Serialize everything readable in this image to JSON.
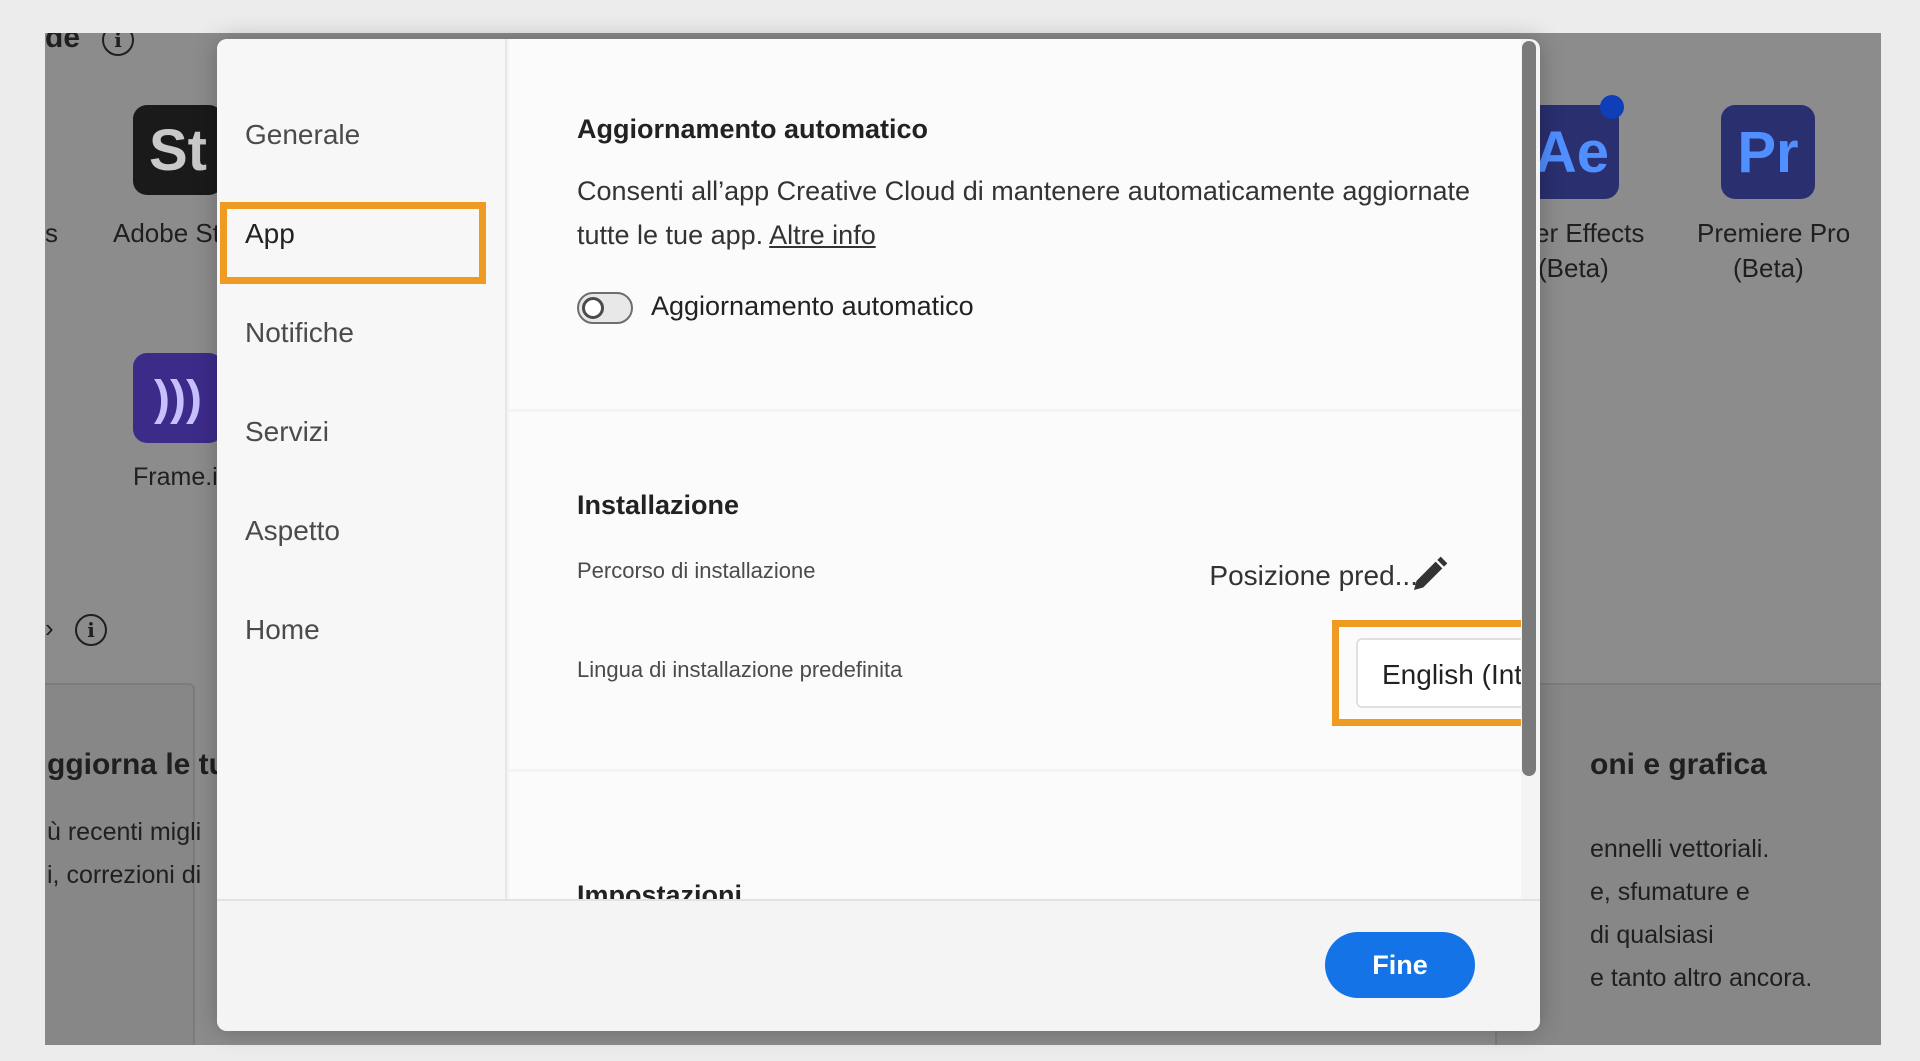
{
  "background": {
    "top_left_text": "de",
    "apps": [
      {
        "icon_text": "St",
        "label": "Adobe St",
        "icon_color": "#1a1a1a",
        "text_color": "#c9c9c9"
      },
      {
        "icon_text": "Ae",
        "label": "er Effects",
        "sublabel": "(Beta)",
        "icon_color": "#2a2f6f",
        "text_color": "#4f8fff"
      },
      {
        "icon_text": "Pr",
        "label": "Premiere Pro",
        "sublabel": "(Beta)",
        "icon_color": "#2a2f6f",
        "text_color": "#4f8fff"
      }
    ],
    "frame_label": "Frame.i",
    "left_partial_label": "s",
    "section_marker": "›",
    "left_card": {
      "title": "ggiorna le tu",
      "line1": "ù recenti migli",
      "line2": "i, correzioni di"
    },
    "right_card": {
      "title": "oni e grafica",
      "lines": [
        "ennelli vettoriali.",
        "e, sfumature e",
        "di qualsiasi",
        "e tanto altro ancora."
      ]
    }
  },
  "modal": {
    "sidebar": {
      "items": [
        {
          "label": "Generale"
        },
        {
          "label": "App"
        },
        {
          "label": "Notifiche"
        },
        {
          "label": "Servizi"
        },
        {
          "label": "Aspetto"
        },
        {
          "label": "Home"
        }
      ],
      "selected": "App"
    },
    "auto_update": {
      "title": "Aggiornamento automatico",
      "description": "Consenti all’app Creative Cloud di mantenere automaticamente aggiornate tutte le tue app.",
      "link": "Altre info",
      "toggle_label": "Aggiornamento automatico",
      "toggle_on": false
    },
    "installation": {
      "title": "Installazione",
      "path_label": "Percorso di installazione",
      "path_value": "Posizione pred...",
      "language_label": "Lingua di installazione predefinita",
      "language_value": "English (International)"
    },
    "settings": {
      "title": "Impostazioni"
    },
    "footer": {
      "done_label": "Fine"
    },
    "colors": {
      "accent": "#1473e6",
      "highlight": "#ef9b23"
    }
  }
}
